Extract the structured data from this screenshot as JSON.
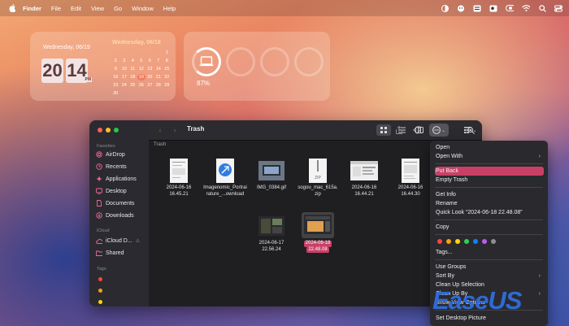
{
  "menubar": {
    "items": [
      "Finder",
      "File",
      "Edit",
      "View",
      "Go",
      "Window",
      "Help"
    ],
    "status_icons": [
      "contrast-icon",
      "people-icon",
      "keyboard-icon",
      "wechat-icon",
      "record-icon",
      "wifi-icon",
      "search-icon",
      "control-center-icon"
    ]
  },
  "widgets": {
    "clock": {
      "date_label": "Wednesday, 06/19",
      "hour": "20",
      "minute": "14",
      "ampm": "PM"
    },
    "calendar": {
      "title": "Wednesday, 06/19",
      "days": [
        "",
        "",
        "",
        "",
        "",
        "",
        "1",
        "2",
        "3",
        "4",
        "5",
        "6",
        "7",
        "8",
        "9",
        "10",
        "11",
        "12",
        "13",
        "14",
        "15",
        "16",
        "17",
        "18",
        "19",
        "20",
        "21",
        "22",
        "23",
        "24",
        "25",
        "26",
        "27",
        "28",
        "29",
        "30"
      ],
      "today": "19"
    },
    "battery": {
      "percent": "87%",
      "value": 0.87
    }
  },
  "finder": {
    "title": "Trash",
    "path": "Trash",
    "sidebar": {
      "favorites_label": "Favorites",
      "favorites": [
        "AirDrop",
        "Recents",
        "Applications",
        "Desktop",
        "Documents",
        "Downloads"
      ],
      "icloud_label": "iCloud",
      "icloud": [
        "iCloud D...",
        "Shared"
      ],
      "tags_label": "Tags",
      "tag_colors": [
        "#ff453a",
        "#ff9f0a",
        "#ffd60a"
      ]
    },
    "files": [
      {
        "name1": "2024-06-16",
        "name2": "16.45.21",
        "kind": "doc"
      },
      {
        "name1": "Imagenomic_Portrai",
        "name2": "rature_...ownload",
        "kind": "download"
      },
      {
        "name1": "IMG_0384.gif",
        "name2": "",
        "kind": "photo"
      },
      {
        "name1": "sogou_mac_615a.",
        "name2": "zip",
        "kind": "zip"
      },
      {
        "name1": "2024-06-16",
        "name2": "16.44.21",
        "kind": "screenshot"
      },
      {
        "name1": "2024-06-16",
        "name2": "16.44.30",
        "kind": "doc"
      },
      {
        "name1": "2024-06-17",
        "name2": "22.56.24",
        "kind": "screenshot-dark"
      },
      {
        "name1": "2024-06-18",
        "name2": "22.48.08",
        "kind": "screenshot-dark",
        "selected": true
      }
    ]
  },
  "context_menu": {
    "items": [
      {
        "label": "Open"
      },
      {
        "label": "Open With",
        "submenu": true
      },
      {
        "label": "Put Back",
        "highlighted": true
      },
      {
        "label": "Empty Trash"
      },
      {
        "label": "Get Info"
      },
      {
        "label": "Rename"
      },
      {
        "label": "Quick Look “2024-06-18 22.48.08”"
      },
      {
        "label": "Copy"
      },
      {
        "label": "Tags..."
      },
      {
        "label": "Use Groups"
      },
      {
        "label": "Sort By",
        "submenu": true
      },
      {
        "label": "Clean Up Selection"
      },
      {
        "label": "Clean Up By",
        "submenu": true
      },
      {
        "label": "Show View Options"
      },
      {
        "label": "Set Desktop Picture"
      }
    ],
    "tag_colors": [
      "#ff453a",
      "#ff9f0a",
      "#ffd60a",
      "#30d158",
      "#0a84ff",
      "#bf5af2",
      "#8e8e93"
    ]
  },
  "watermark": "EaseUS",
  "colors": {
    "accent": "#c94067",
    "watermark": "#2f6ad6"
  }
}
